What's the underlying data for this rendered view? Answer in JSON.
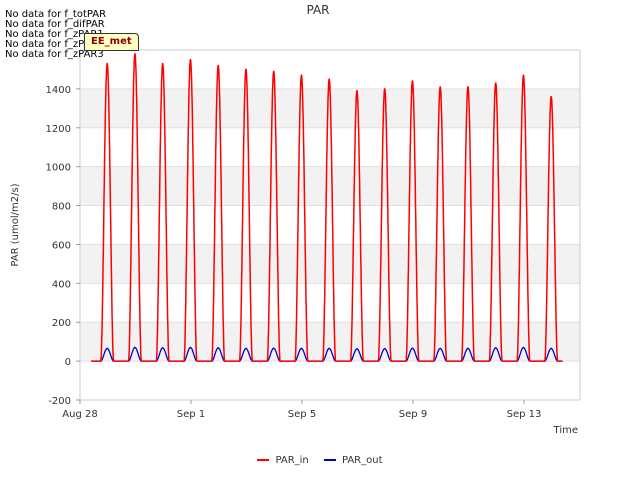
{
  "no_data": [
    "No data for f_totPAR",
    "No data for f_difPAR",
    "No data for f_zPAR1",
    "No data for f_zPAR2",
    "No data for f_zPAR3"
  ],
  "badge": "EE_met",
  "chart_data": {
    "type": "line",
    "title": "PAR",
    "xlabel": "Time",
    "ylabel": "PAR (umol/m2/s)",
    "ylim": [
      -200,
      1600
    ],
    "yticks": [
      -200,
      0,
      200,
      400,
      600,
      800,
      1000,
      1200,
      1400
    ],
    "xlim_days": [
      "Aug 28",
      "Sep 15"
    ],
    "xticks": [
      "Aug 28",
      "Sep 1",
      "Sep 5",
      "Sep 9",
      "Sep 13"
    ],
    "grid": "horizontal bands",
    "legend_position": "bottom",
    "series": [
      {
        "name": "PAR_in",
        "color": "#ff0000",
        "daily_peaks": [
          {
            "date": "Aug 28",
            "peak": 1530
          },
          {
            "date": "Aug 29",
            "peak": 1580
          },
          {
            "date": "Aug 30",
            "peak": 1530
          },
          {
            "date": "Aug 31",
            "peak": 1550
          },
          {
            "date": "Sep 1",
            "peak": 1520
          },
          {
            "date": "Sep 2",
            "peak": 1500
          },
          {
            "date": "Sep 3",
            "peak": 1490
          },
          {
            "date": "Sep 4",
            "peak": 1470
          },
          {
            "date": "Sep 5",
            "peak": 1450
          },
          {
            "date": "Sep 6",
            "peak": 1390
          },
          {
            "date": "Sep 7",
            "peak": 1400
          },
          {
            "date": "Sep 8",
            "peak": 1440
          },
          {
            "date": "Sep 9",
            "peak": 1410
          },
          {
            "date": "Sep 10",
            "peak": 1410
          },
          {
            "date": "Sep 11",
            "peak": 1430
          },
          {
            "date": "Sep 12",
            "peak": 1470
          },
          {
            "date": "Sep 13",
            "peak": 1360
          }
        ]
      },
      {
        "name": "PAR_out",
        "color": "#0000cc",
        "daily_peaks": [
          {
            "date": "Aug 28",
            "peak": 65
          },
          {
            "date": "Aug 29",
            "peak": 70
          },
          {
            "date": "Aug 30",
            "peak": 68
          },
          {
            "date": "Aug 31",
            "peak": 70
          },
          {
            "date": "Sep 1",
            "peak": 68
          },
          {
            "date": "Sep 2",
            "peak": 65
          },
          {
            "date": "Sep 3",
            "peak": 66
          },
          {
            "date": "Sep 4",
            "peak": 65
          },
          {
            "date": "Sep 5",
            "peak": 65
          },
          {
            "date": "Sep 6",
            "peak": 63
          },
          {
            "date": "Sep 7",
            "peak": 64
          },
          {
            "date": "Sep 8",
            "peak": 66
          },
          {
            "date": "Sep 9",
            "peak": 65
          },
          {
            "date": "Sep 10",
            "peak": 65
          },
          {
            "date": "Sep 11",
            "peak": 68
          },
          {
            "date": "Sep 12",
            "peak": 70
          },
          {
            "date": "Sep 13",
            "peak": 65
          }
        ]
      }
    ]
  }
}
